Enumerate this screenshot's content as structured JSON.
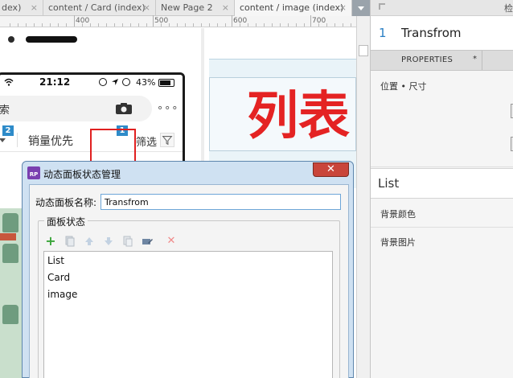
{
  "tabs": [
    {
      "label": "dex)",
      "close": "×"
    },
    {
      "label": "content / Card (index)",
      "close": "×"
    },
    {
      "label": "New Page 2",
      "close": "×"
    },
    {
      "label": "content / image (index)",
      "close": "×"
    }
  ],
  "ruler": {
    "labels": [
      "400",
      "500",
      "600",
      "700"
    ]
  },
  "phone": {
    "time": "21:12",
    "battery_pct": "43%",
    "search_text": "索",
    "more": "∘∘∘",
    "sales_priority": "销量优先",
    "screen_filter": "筛选"
  },
  "badges": {
    "left": "2",
    "selected": "1"
  },
  "preview": {
    "big_text": "列表"
  },
  "dialog": {
    "app_icon": "RP",
    "title": "动态面板状态管理",
    "close": "✕",
    "name_label": "动态面板名称:",
    "name_value": "Transfrom",
    "group_label": "面板状态",
    "toolbar_icons": [
      "add-icon",
      "duplicate-icon",
      "move-up-icon",
      "move-down-icon",
      "edit-all-icon",
      "edit-icon",
      "delete-icon"
    ],
    "states": [
      "List",
      "Card",
      "image"
    ]
  },
  "right_panel": {
    "header_text": "检",
    "index": "1",
    "name": "Transfrom",
    "tab_label": "PROPERTIES",
    "tab_marker": "*",
    "position_size": "位置 • 尺寸",
    "state_name": "List",
    "bg_color": "背景颜色",
    "bg_image": "背景图片"
  },
  "colors": {
    "accent_blue": "#2e8bc9",
    "selection_red": "#e02020",
    "big_text_red": "#e42323",
    "close_red": "#c9453a",
    "dialog_blue": "#cfe1f2"
  }
}
